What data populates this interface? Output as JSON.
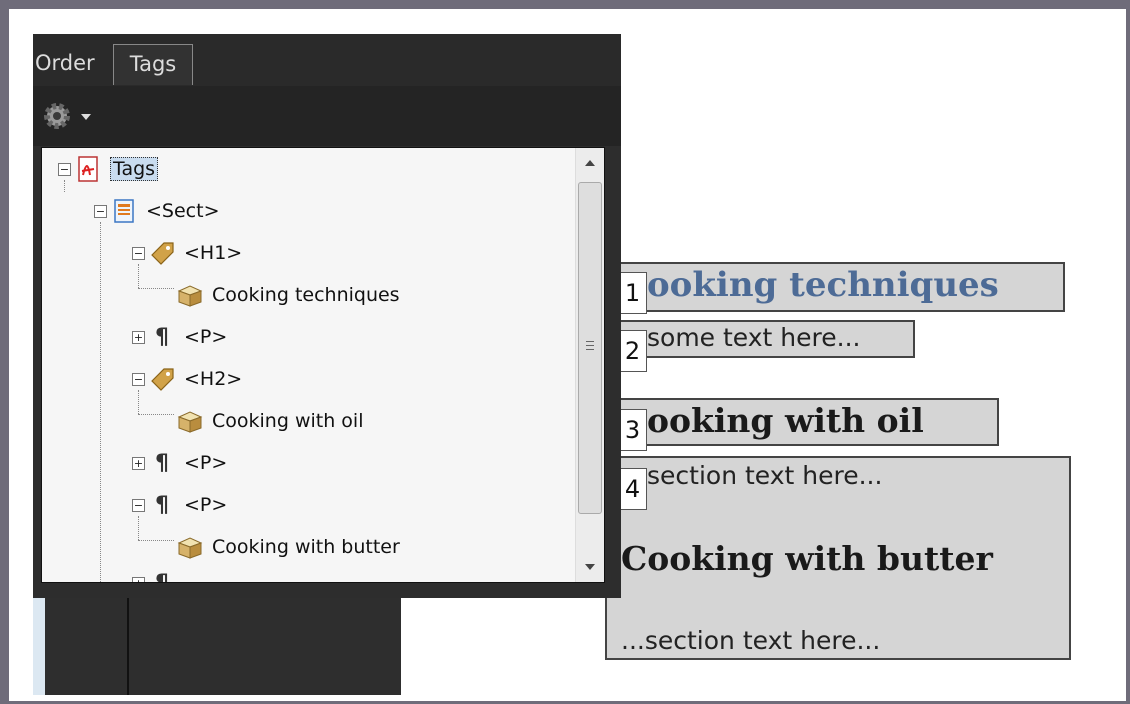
{
  "tabs": {
    "order": "Order",
    "tags": "Tags"
  },
  "toolbar": {
    "options_icon": "gear-icon"
  },
  "tree": {
    "root": "Tags",
    "sect": "<Sect>",
    "h1": "<H1>",
    "h1_content": "Cooking techniques",
    "p1": "<P>",
    "h2": "<H2>",
    "h2_content": "Cooking with oil",
    "p2": "<P>",
    "p3": "<P>",
    "p3_content": "Cooking with butter"
  },
  "document": {
    "block1": {
      "number": "1",
      "text": "ooking techniques"
    },
    "block2": {
      "number": "2",
      "text": "some text here..."
    },
    "block3": {
      "number": "3",
      "text": "ooking with oil"
    },
    "block4": {
      "number": "4",
      "text1": "section text here...",
      "heading": "Cooking with butter",
      "text2": "...section text here..."
    }
  },
  "colors": {
    "heading_blue": "#4d6b96",
    "selection": "#c9dcef",
    "panel_bg": "#2d2d2d",
    "doc_box": "#d5d5d5"
  }
}
